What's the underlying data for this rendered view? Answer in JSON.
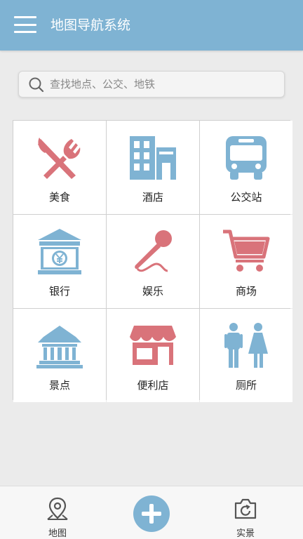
{
  "header": {
    "title": "地图导航系统",
    "menu_icon": "hamburger-icon"
  },
  "search": {
    "placeholder": "查找地点、公交、地铁",
    "value": "",
    "icon": "search-icon"
  },
  "categories": [
    {
      "label": "美食",
      "icon": "fork-knife-icon"
    },
    {
      "label": "酒店",
      "icon": "hotel-building-icon"
    },
    {
      "label": "公交站",
      "icon": "bus-icon"
    },
    {
      "label": "银行",
      "icon": "bank-yen-icon"
    },
    {
      "label": "娱乐",
      "icon": "microphone-icon"
    },
    {
      "label": "商场",
      "icon": "shopping-cart-icon"
    },
    {
      "label": "景点",
      "icon": "temple-icon"
    },
    {
      "label": "便利店",
      "icon": "store-icon"
    },
    {
      "label": "厕所",
      "icon": "restroom-icon"
    }
  ],
  "bottom_nav": {
    "map_label": "地图",
    "map_icon": "map-pin-icon",
    "add_icon": "plus-icon",
    "live_label": "实景",
    "live_icon": "camera-icon"
  },
  "colors": {
    "header": "#7fb3d3",
    "red_icon": "#d9737a",
    "blue_icon": "#7fb3d3"
  }
}
